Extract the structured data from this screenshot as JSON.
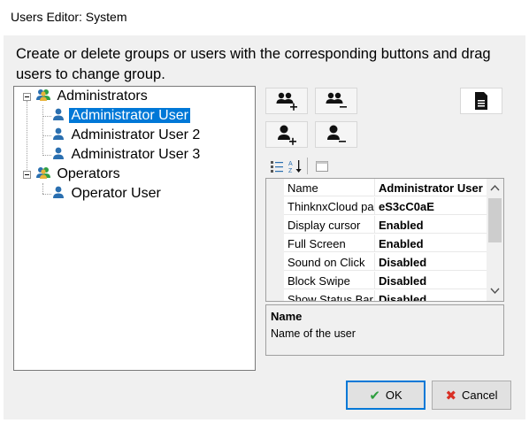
{
  "window": {
    "title": "Users Editor: System"
  },
  "instructions": "Create or delete groups or users with the corresponding buttons and drag users to change group.",
  "tree": {
    "groups": [
      {
        "label": "Administrators",
        "users": [
          "Administrator User",
          "Administrator User 2",
          "Administrator User 3"
        ]
      },
      {
        "label": "Operators",
        "users": [
          "Operator User"
        ]
      }
    ],
    "selected": "Administrator User"
  },
  "toolbar": {
    "add_group_icon": "add-group-icon",
    "remove_group_icon": "remove-group-icon",
    "add_user_icon": "add-user-icon",
    "remove_user_icon": "remove-user-icon",
    "document_icon": "document-icon",
    "categorized_icon": "categorized-icon",
    "sort_az_icon": "sort-az-icon",
    "property_pages_icon": "property-pages-icon"
  },
  "properties": {
    "rows": [
      {
        "name": "Name",
        "value": "Administrator User"
      },
      {
        "name": "ThinknxCloud password",
        "value": "eS3cC0aE"
      },
      {
        "name": "Display cursor",
        "value": "Enabled"
      },
      {
        "name": "Full Screen",
        "value": "Enabled"
      },
      {
        "name": "Sound on Click",
        "value": "Disabled"
      },
      {
        "name": "Block Swipe",
        "value": "Disabled"
      },
      {
        "name": "Show Status Bar",
        "value": "Disabled"
      }
    ]
  },
  "description": {
    "title": "Name",
    "text": "Name of the user"
  },
  "buttons": {
    "ok": "OK",
    "cancel": "Cancel"
  },
  "colors": {
    "selection": "#0078d7",
    "ok_check": "#2e9e3e",
    "cancel_x": "#d93025",
    "group_icon_green": "#2f9e45",
    "user_icon_blue": "#2a6fb0"
  }
}
